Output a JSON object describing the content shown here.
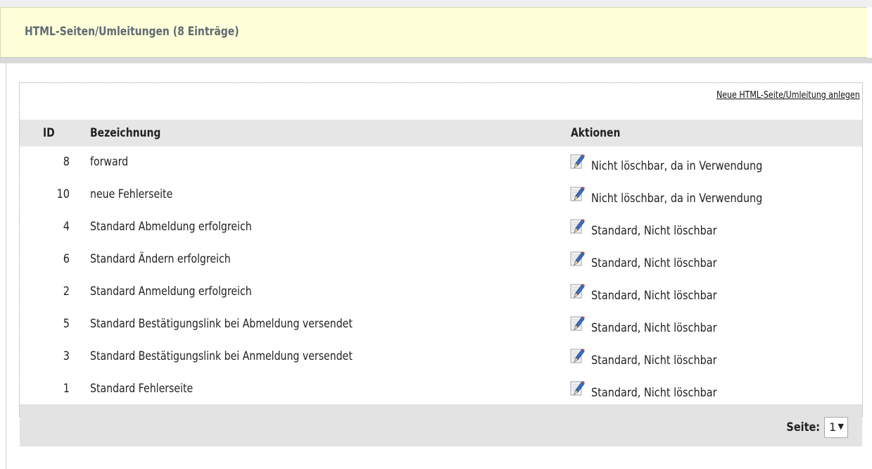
{
  "header": {
    "title": "HTML-Seiten/Umleitungen (8 Einträge)"
  },
  "panel": {
    "new_link": "Neue HTML-Seite/Umleitung anlegen",
    "columns": {
      "id": "ID",
      "name": "Bezeichnung",
      "actions": "Aktionen"
    },
    "rows": [
      {
        "id": "8",
        "name": "forward",
        "action": "Nicht löschbar, da in Verwendung",
        "icon": "edit-icon"
      },
      {
        "id": "10",
        "name": "neue Fehlerseite",
        "action": "Nicht löschbar, da in Verwendung",
        "icon": "edit-icon"
      },
      {
        "id": "4",
        "name": "Standard Abmeldung erfolgreich",
        "action": "Standard, Nicht löschbar",
        "icon": "edit-icon"
      },
      {
        "id": "6",
        "name": "Standard Ändern erfolgreich",
        "action": "Standard, Nicht löschbar",
        "icon": "edit-icon"
      },
      {
        "id": "2",
        "name": "Standard Anmeldung erfolgreich",
        "action": "Standard, Nicht löschbar",
        "icon": "edit-icon"
      },
      {
        "id": "5",
        "name": "Standard Bestätigungslink bei Abmeldung versendet",
        "action": "Standard, Nicht löschbar",
        "icon": "edit-icon"
      },
      {
        "id": "3",
        "name": "Standard Bestätigungslink bei Anmeldung versendet",
        "action": "Standard, Nicht löschbar",
        "icon": "edit-icon"
      },
      {
        "id": "1",
        "name": "Standard Fehlerseite",
        "action": "Standard, Nicht löschbar",
        "icon": "edit-icon"
      }
    ],
    "pagination": {
      "label": "Seite:",
      "current": "1",
      "icon": "chevron-down-icon"
    }
  },
  "colors": {
    "header_bg": "#ffffd9",
    "header_text": "#5f6a73",
    "table_header_bg": "#e6e6e6",
    "footer_bg": "#e3e3e3"
  }
}
